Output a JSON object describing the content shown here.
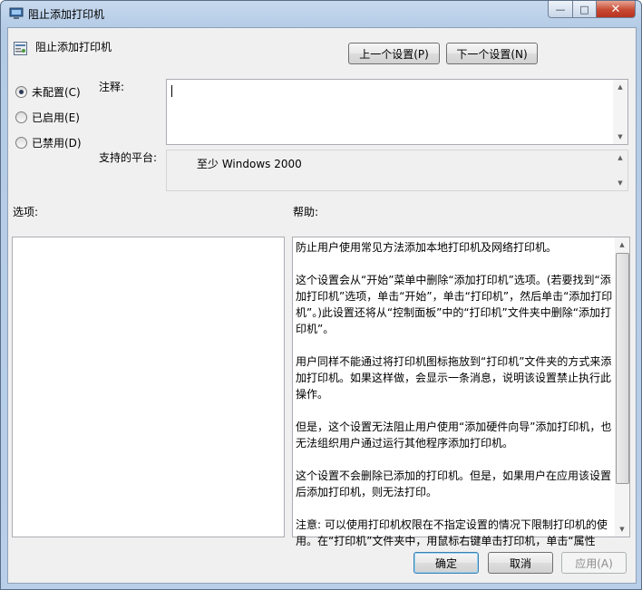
{
  "window": {
    "title": "阻止添加打印机"
  },
  "caption_buttons": {
    "minimize": "—",
    "maximize": "□",
    "close": "✕"
  },
  "policy": {
    "name": "阻止添加打印机"
  },
  "nav": {
    "prev_label": "上一个设置(P)",
    "next_label": "下一个设置(N)"
  },
  "state": {
    "options": [
      {
        "label": "未配置(C)",
        "checked": true
      },
      {
        "label": "已启用(E)",
        "checked": false
      },
      {
        "label": "已禁用(D)",
        "checked": false
      }
    ]
  },
  "comment": {
    "label": "注释:",
    "value": ""
  },
  "platform": {
    "label": "支持的平台:",
    "value": "至少 Windows 2000"
  },
  "options_panel": {
    "label": "选项:"
  },
  "help": {
    "label": "帮助:",
    "paragraphs": [
      "防止用户使用常见方法添加本地打印机及网络打印机。",
      "这个设置会从“开始”菜单中删除“添加打印机”选项。(若要找到“添加打印机”选项，单击“开始”，单击“打印机”，然后单击“添加打印机”。)此设置还将从“控制面板”中的“打印机”文件夹中删除“添加打印机”。",
      "用户同样不能通过将打印机图标拖放到“打印机”文件夹的方式来添加打印机。如果这样做，会显示一条消息，说明该设置禁止执行此操作。",
      "但是，这个设置无法阻止用户使用“添加硬件向导”添加打印机，也无法组织用户通过运行其他程序添加打印机。",
      "这个设置不会删除已添加的打印机。但是，如果用户在应用该设置后添加打印机，则无法打印。",
      "注意: 可以使用打印机权限在不指定设置的情况下限制打印机的使用。在“打印机”文件夹中，用鼠标右键单击打印机，单击“属性"
    ]
  },
  "footer": {
    "ok_label": "确定",
    "cancel_label": "取消",
    "apply_label": "应用(A)"
  }
}
